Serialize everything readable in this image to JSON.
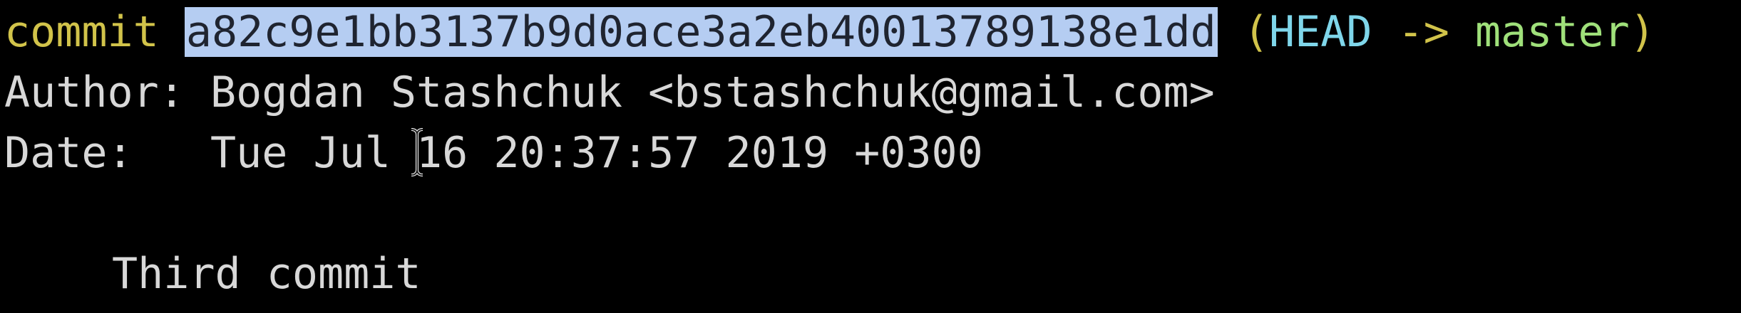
{
  "terminal": {
    "lines": {
      "commit_keyword": "commit",
      "commit_hash": "a82c9e1bb3137b9d0ace3a2eb40013789138e1dd",
      "ref_open": "(",
      "head": "HEAD",
      "arrow": " -> ",
      "branch": "master",
      "ref_close": ")",
      "author_label": "Author:",
      "author_value": "Bogdan Stashchuk <bstashchuk@gmail.com>",
      "date_label": "Date:",
      "date_value": "Tue Jul 16 20:37:57 2019 +0300",
      "message": "Third commit"
    },
    "colors": {
      "background": "#000000",
      "commit_keyword": "#d1c34a",
      "head": "#7fd6ea",
      "branch": "#9fe07a",
      "text": "#d8d8d8",
      "selection": "#b5cdf2"
    },
    "cursor": "text-cursor-icon"
  }
}
